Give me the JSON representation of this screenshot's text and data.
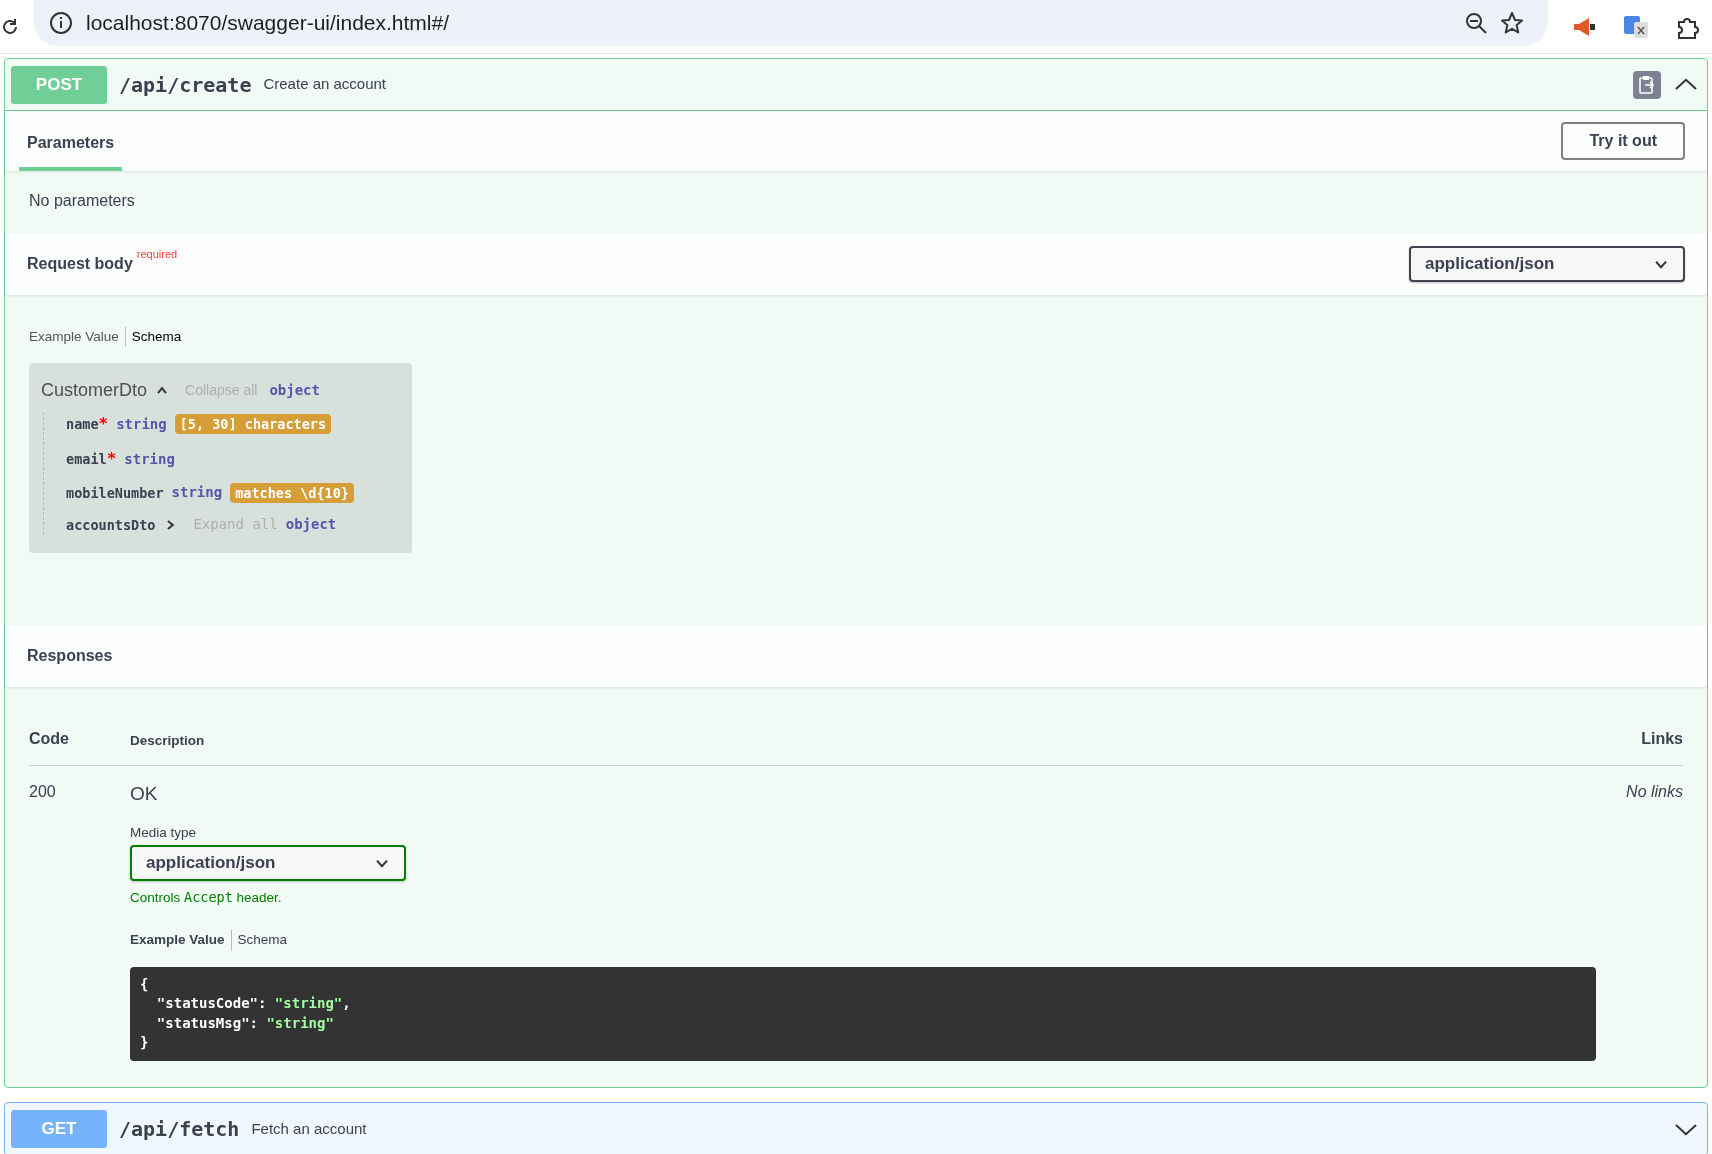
{
  "browser": {
    "url": "localhost:8070/swagger-ui/index.html#/"
  },
  "operations": [
    {
      "method": "POST",
      "color": "#6fcf97",
      "path": "/api/create",
      "summary": "Create an account",
      "expanded": true,
      "tabs": [
        {
          "label": "Parameters",
          "selected": true
        }
      ],
      "try_button": "Try it out",
      "parameters_text": "No parameters",
      "request_body": {
        "title": "Request body",
        "required_label": "required",
        "media_type": "application/json",
        "view_tabs": [
          {
            "label": "Example Value",
            "selected": false
          },
          {
            "label": "Schema",
            "selected": true
          }
        ],
        "schema": {
          "name": "CustomerDto",
          "expanded": true,
          "toggle": "Collapse all",
          "type": "object",
          "required_mark": "*",
          "properties": [
            {
              "name": "name",
              "required": true,
              "type": "string",
              "constraint": "[5, 30] characters"
            },
            {
              "name": "email",
              "required": true,
              "type": "string"
            },
            {
              "name": "mobileNumber",
              "required": false,
              "type": "string",
              "constraint": "matches \\d{10}"
            },
            {
              "name": "accountsDto",
              "required": false,
              "kind": "object",
              "expanded": false,
              "toggle": "Expand all",
              "type": "object"
            }
          ]
        }
      },
      "responses": {
        "title": "Responses",
        "columns": [
          "Code",
          "Description",
          "Links"
        ],
        "rows": [
          {
            "code": "200",
            "description": "OK",
            "links": "No links",
            "media_type_label": "Media type",
            "media_type": "application/json",
            "note_before": "Controls",
            "note_code": "Accept",
            "note_after": "header.",
            "view_tabs": [
              {
                "label": "Example Value",
                "selected": true
              },
              {
                "label": "Schema",
                "selected": false
              }
            ],
            "example_lines": [
              "{",
              "  \"statusCode\": \"string\",",
              "  \"statusMsg\": \"string\"",
              "}"
            ]
          }
        ]
      }
    },
    {
      "method": "GET",
      "color": "#76b3fa",
      "path": "/api/fetch",
      "summary": "Fetch an account",
      "expanded": false
    }
  ]
}
